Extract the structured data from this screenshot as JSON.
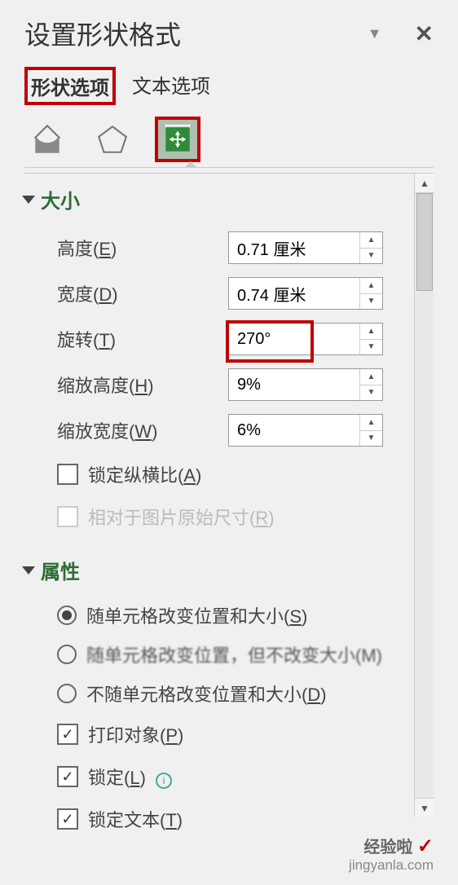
{
  "header": {
    "title": "设置形状格式"
  },
  "tabs": {
    "shape_options": "形状选项",
    "text_options": "文本选项"
  },
  "size_section": {
    "title": "大小",
    "height_label": "高度(E)",
    "height_value": "0.71 厘米",
    "width_label": "宽度(D)",
    "width_value": "0.74 厘米",
    "rotation_label": "旋转(T)",
    "rotation_value": "270°",
    "scale_h_label": "缩放高度(H)",
    "scale_h_value": "9%",
    "scale_w_label": "缩放宽度(W)",
    "scale_w_value": "6%",
    "lock_aspect_label": "锁定纵横比(A)",
    "relative_original_label": "相对于图片原始尺寸(R)"
  },
  "prop_section": {
    "title": "属性",
    "radio1": "随单元格改变位置和大小(S)",
    "radio2": "随单元格改变位置，但不改变大小(M)",
    "radio3": "不随单元格改变位置和大小(D)",
    "print_label": "打印对象(P)",
    "lock_label": "锁定(L)",
    "lock_text_label": "锁定文本(T)"
  },
  "chart_data": null,
  "watermark": {
    "line1": "经验啦",
    "line2": "jingyanla.com"
  }
}
